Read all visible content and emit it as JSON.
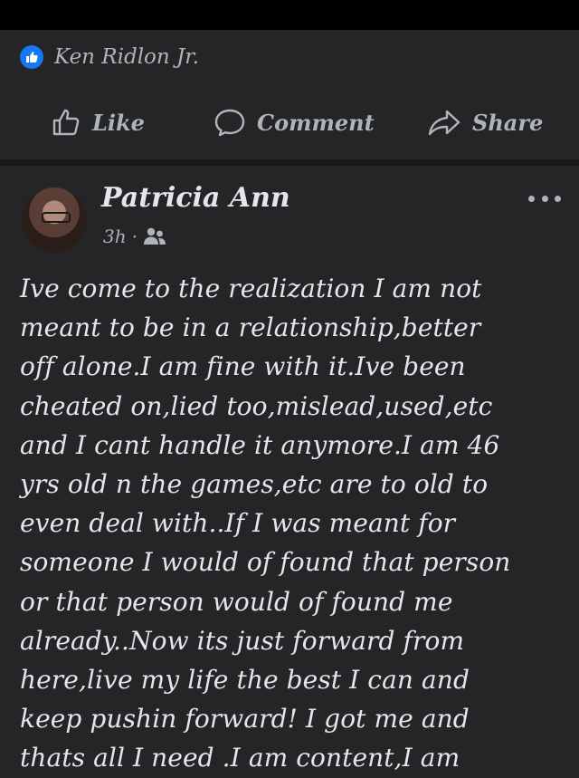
{
  "previous_post": {
    "liker_name": "Ken Ridlon Jr.",
    "actions": [
      {
        "label": "Like",
        "icon": "thumbs-up-icon"
      },
      {
        "label": "Comment",
        "icon": "comment-bubble-icon"
      },
      {
        "label": "Share",
        "icon": "share-arrow-icon"
      }
    ]
  },
  "post": {
    "author": "Patricia Ann",
    "time": "3h",
    "separator": "·",
    "audience_icon": "friends-icon",
    "more_icon": "more-options-icon",
    "text": "Ive come to the realization I am not\nmeant to be in a relationship,better\noff alone.I am fine with it.Ive been\ncheated on,lied too,mislead,used,etc\nand I cant handle it anymore.I am 46\nyrs old n the games,etc are to old to\neven deal with..If I was meant for\nsomeone I would of found that person\nor that person would of found me\nalready..Now its just forward from\nhere,live my life the best I can and\nkeep pushin forward! I got me and\nthats all I need .I am content,I am"
  },
  "colors": {
    "background": "#242526",
    "divider": "#18191a",
    "text": "#e4e6eb",
    "secondary_text": "#b0b3b8",
    "like_badge": "#1877f2"
  }
}
